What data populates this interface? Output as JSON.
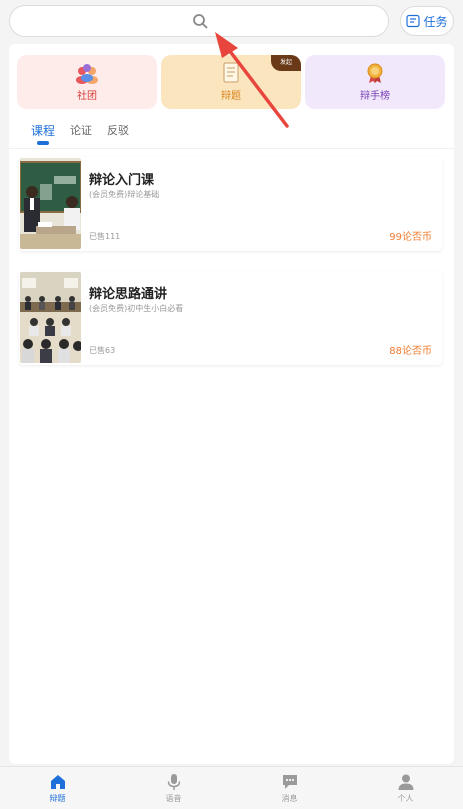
{
  "header": {
    "search": {
      "placeholder": "",
      "icon": "search-icon"
    },
    "task_button": {
      "label": "任务",
      "icon": "task-list-icon"
    }
  },
  "categories": [
    {
      "label": "社团",
      "icon": "group-icon",
      "color": "#d93a36"
    },
    {
      "label": "辩题",
      "icon": "notebook-icon",
      "color": "#d8841a",
      "badge": "发起"
    },
    {
      "label": "辩手榜",
      "icon": "medal-icon",
      "color": "#7a3fb6"
    }
  ],
  "tabs": [
    {
      "label": "课程",
      "active": true
    },
    {
      "label": "论证",
      "active": false
    },
    {
      "label": "反驳",
      "active": false
    }
  ],
  "courses": [
    {
      "title": "辩论入门课",
      "subtitle": "(会员免费)辩论基础",
      "sold": "已售111",
      "price": "99论否币"
    },
    {
      "title": "辩论思路通讲",
      "subtitle": "(会员免费)初中生小白必看",
      "sold": "已售63",
      "price": "88论否币"
    }
  ],
  "bottom_nav": [
    {
      "label": "辩题",
      "icon": "home-icon",
      "active": true
    },
    {
      "label": "语音",
      "icon": "microphone-icon",
      "active": false
    },
    {
      "label": "消息",
      "icon": "message-icon",
      "active": false
    },
    {
      "label": "个人",
      "icon": "person-icon",
      "active": false
    }
  ],
  "colors": {
    "accent": "#1e6fd9",
    "price": "#f07b2e",
    "annotation_arrow": "#e8453c"
  }
}
